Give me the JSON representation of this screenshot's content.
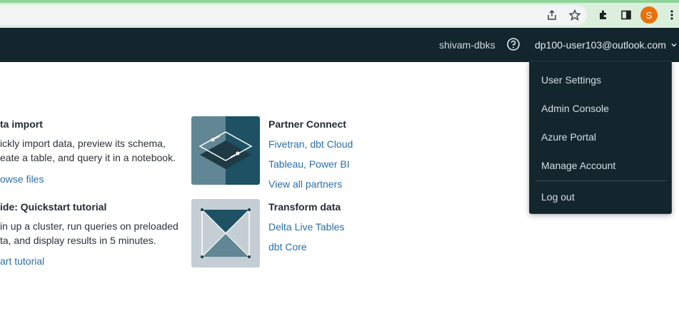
{
  "browser": {
    "avatar_initial": "S",
    "accent_color": "#e8710a"
  },
  "header": {
    "workspace": "shivam-dbks",
    "user_email": "dp100-user103@outlook.com"
  },
  "user_menu": {
    "items": [
      {
        "label": "User Settings"
      },
      {
        "label": "Admin Console"
      },
      {
        "label": "Azure Portal"
      },
      {
        "label": "Manage Account"
      }
    ],
    "logout": "Log out"
  },
  "cards": {
    "data_import": {
      "title": "ta import",
      "line1": "ickly import data, preview its schema,",
      "line2": "eate a table, and query it in a notebook.",
      "link": "owse files"
    },
    "quickstart": {
      "title": "ide: Quickstart tutorial",
      "line1": "in up a cluster, run queries on preloaded",
      "line2": "ta, and display results in 5 minutes.",
      "link": "art tutorial"
    },
    "partner_connect": {
      "title": "Partner Connect",
      "links": [
        "Fivetran, dbt Cloud",
        "Tableau, Power BI",
        "View all partners"
      ]
    },
    "transform_data": {
      "title": "Transform data",
      "links": [
        "Delta Live Tables",
        "dbt Core"
      ]
    }
  }
}
